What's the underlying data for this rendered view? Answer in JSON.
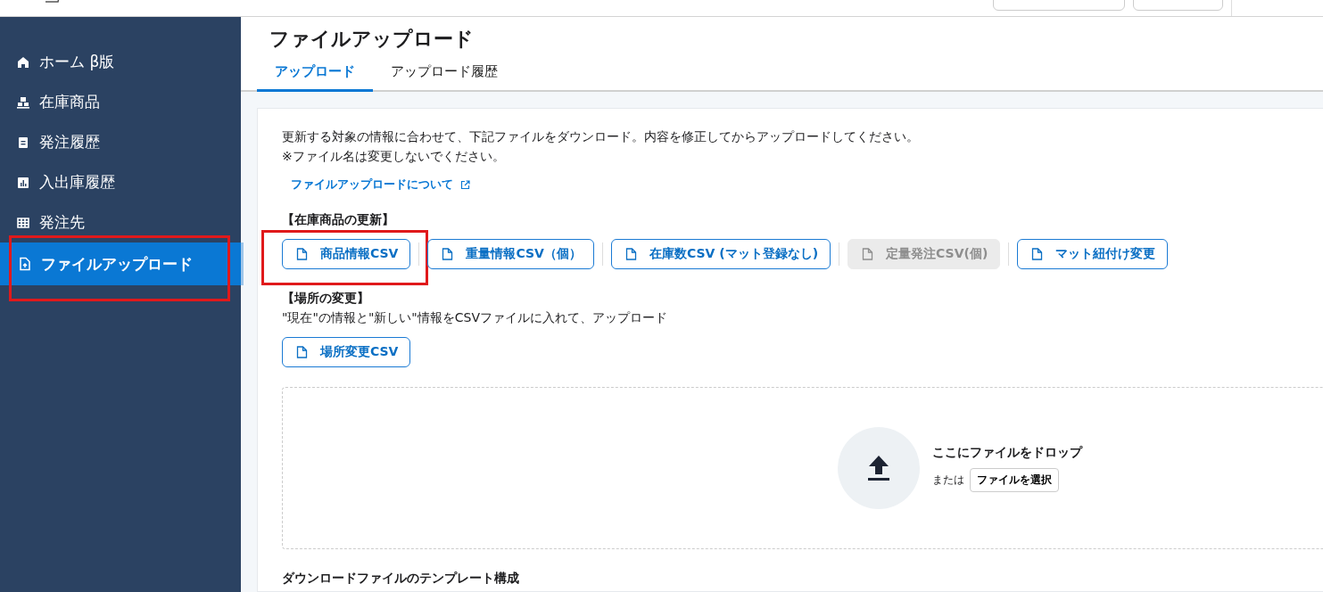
{
  "sidebar": {
    "items": [
      {
        "label": "ホーム β版",
        "selected": false
      },
      {
        "label": "在庫商品",
        "selected": false
      },
      {
        "label": "発注履歴",
        "selected": false
      },
      {
        "label": "入出庫履歴",
        "selected": false
      },
      {
        "label": "発注先",
        "selected": false
      },
      {
        "label": "ファイルアップロード",
        "selected": true,
        "highlighted": true
      }
    ]
  },
  "page_title": "ファイルアップロード",
  "tabs": [
    {
      "label": "アップロード",
      "selected": true
    },
    {
      "label": "アップロード履歴",
      "selected": false
    }
  ],
  "intro": [
    "更新する対象の情報に合わせて、下記ファイルをダウンロード。内容を修正してからアップロードしてください。",
    "※ファイル名は変更しないでください。"
  ],
  "help_link": "ファイルアップロードについて",
  "sections": [
    {
      "heading": "【在庫商品の更新】",
      "buttons": [
        {
          "label": "商品情報CSV",
          "disabled": false,
          "highlighted": true
        },
        {
          "label": "重量情報CSV（個）",
          "disabled": false,
          "highlighted": false
        },
        {
          "label": "在庫数CSV (マット登録なし)",
          "disabled": false,
          "highlighted": false
        },
        {
          "label": "定量発注CSV(個)",
          "disabled": true,
          "highlighted": false
        },
        {
          "label": "マット紐付け変更",
          "disabled": false,
          "highlighted": false
        }
      ]
    },
    {
      "heading": "【場所の変更】",
      "description": "\"現在\"の情報と\"新しい\"情報をCSVファイルに入れて、アップロード",
      "buttons": [
        {
          "label": "場所変更CSV",
          "disabled": false,
          "highlighted": false
        }
      ]
    }
  ],
  "dropzone": {
    "title": "ここにファイルをドロップ",
    "or": "または",
    "button": "ファイルを選択"
  },
  "next_heading": "ダウンロードファイルのテンプレート構成"
}
